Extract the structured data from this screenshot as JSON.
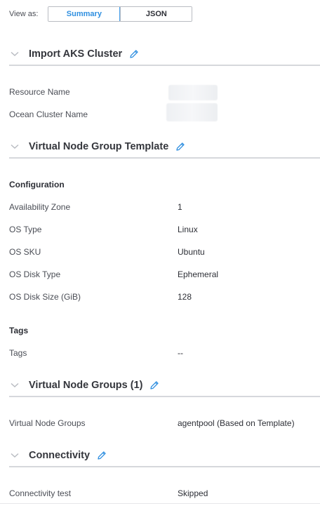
{
  "view_as": {
    "label": "View as:",
    "options": [
      "Summary",
      "JSON"
    ],
    "selected": "Summary"
  },
  "sections": {
    "import": {
      "title": "Import AKS Cluster"
    },
    "vng_template": {
      "title": "Virtual Node Group Template"
    },
    "vngs": {
      "title": "Virtual Node Groups (1)"
    },
    "connectivity": {
      "title": "Connectivity"
    }
  },
  "import_fields": {
    "resource_name_label": "Resource Name",
    "ocean_cluster_name_label": "Ocean Cluster Name"
  },
  "configuration": {
    "heading": "Configuration",
    "rows": [
      {
        "label": "Availability Zone",
        "value": "1"
      },
      {
        "label": "OS Type",
        "value": "Linux"
      },
      {
        "label": "OS SKU",
        "value": "Ubuntu"
      },
      {
        "label": "OS Disk Type",
        "value": "Ephemeral"
      },
      {
        "label": "OS Disk Size (GiB)",
        "value": "128"
      }
    ]
  },
  "tags": {
    "heading": "Tags",
    "label": "Tags",
    "value": "--"
  },
  "vng_row": {
    "label": "Virtual Node Groups",
    "value": "agentpool (Based on Template)"
  },
  "connectivity_row": {
    "label": "Connectivity test",
    "value": "Skipped"
  },
  "colors": {
    "accent": "#2f8fe0",
    "divider": "#d6d8dc",
    "edit_icon": "#2f8fe0"
  },
  "icons": {
    "collapse": "chevron-down-icon",
    "edit": "pencil-icon"
  }
}
